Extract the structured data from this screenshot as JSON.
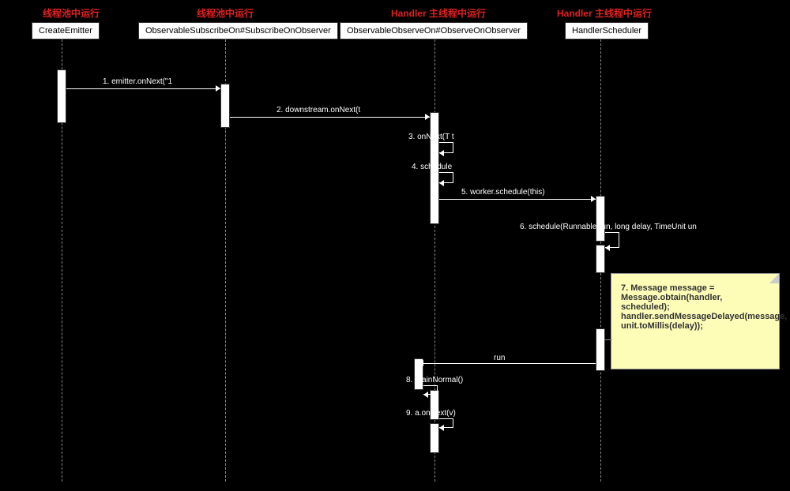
{
  "headers": {
    "h1": "线程池中运行",
    "h2": "线程池中运行",
    "h3": "Handler 主线程中运行",
    "h4": "Handler 主线程中运行"
  },
  "lifelines": {
    "l1": "CreateEmitter",
    "l2": "ObservableSubscribeOn#SubscribeOnObserver",
    "l3": "ObservableObserveOn#ObserveOnObserver",
    "l4": "HandlerScheduler"
  },
  "messages": {
    "m1": "1. emitter.onNext(\"1",
    "m2": "2. downstream.onNext(t",
    "m3": "3. onNext(T t",
    "m4": "4. schedule",
    "m5": "5. worker.schedule(this)",
    "m6": "6. schedule(Runnable run, long delay, TimeUnit un",
    "m7": "run",
    "m8": "8. drainNormal()",
    "m9": "9. a.onNext(v)"
  },
  "note": {
    "line1": "7. Message message =",
    "line2": "Message.obtain(handler, scheduled);",
    "line3": " handler.sendMessageDelayed(message,",
    "line4": "unit.toMillis(delay));"
  }
}
